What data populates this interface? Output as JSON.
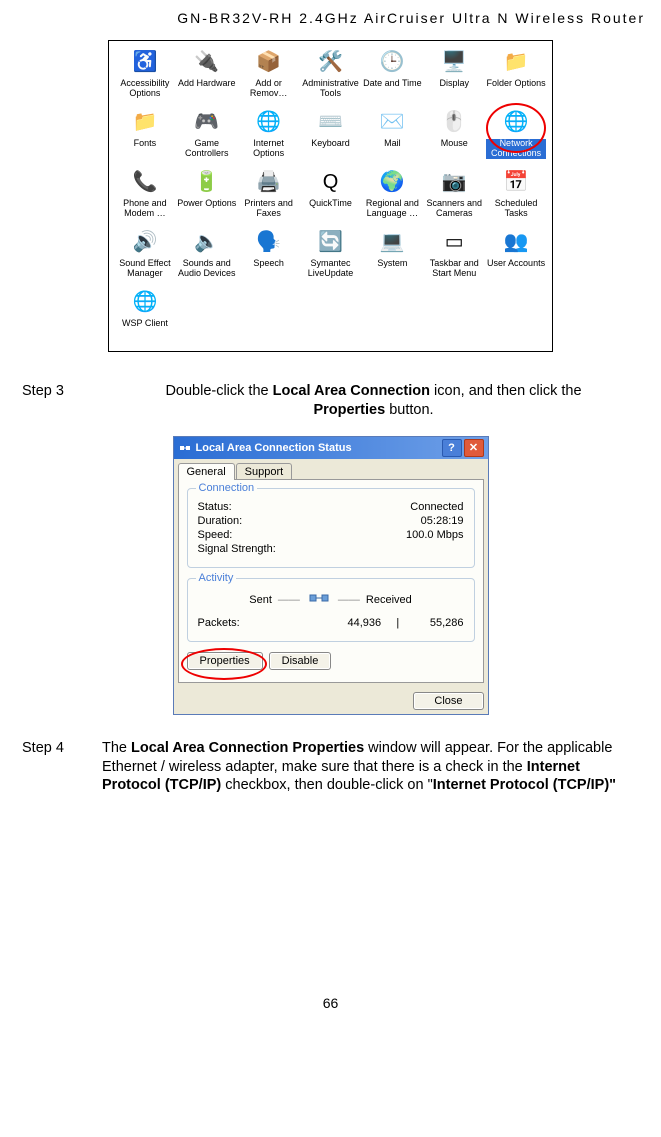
{
  "header": "GN-BR32V-RH  2.4GHz  AirCruiser  Ultra  N  Wireless  Router",
  "controlPanel": {
    "items": [
      {
        "label": "Accessibility Options",
        "glyph": "♿"
      },
      {
        "label": "Add Hardware",
        "glyph": "🔌"
      },
      {
        "label": "Add or Remov…",
        "glyph": "📦"
      },
      {
        "label": "Administrative Tools",
        "glyph": "🛠️"
      },
      {
        "label": "Date and Time",
        "glyph": "🕒"
      },
      {
        "label": "Display",
        "glyph": "🖥️"
      },
      {
        "label": "Folder Options",
        "glyph": "📁"
      },
      {
        "label": "Fonts",
        "glyph": "📁"
      },
      {
        "label": "Game Controllers",
        "glyph": "🎮"
      },
      {
        "label": "Internet Options",
        "glyph": "🌐"
      },
      {
        "label": "Keyboard",
        "glyph": "⌨️"
      },
      {
        "label": "Mail",
        "glyph": "✉️"
      },
      {
        "label": "Mouse",
        "glyph": "🖱️"
      },
      {
        "label": "Network Connections",
        "glyph": "🌐",
        "selected": true,
        "highlighted": true
      },
      {
        "label": "Phone and Modem …",
        "glyph": "📞"
      },
      {
        "label": "Power Options",
        "glyph": "🔋"
      },
      {
        "label": "Printers and Faxes",
        "glyph": "🖨️"
      },
      {
        "label": "QuickTime",
        "glyph": "Q"
      },
      {
        "label": "Regional and Language …",
        "glyph": "🌍"
      },
      {
        "label": "Scanners and Cameras",
        "glyph": "📷"
      },
      {
        "label": "Scheduled Tasks",
        "glyph": "📅"
      },
      {
        "label": "Sound Effect Manager",
        "glyph": "🔊"
      },
      {
        "label": "Sounds and Audio Devices",
        "glyph": "🔈"
      },
      {
        "label": "Speech",
        "glyph": "🗣️"
      },
      {
        "label": "Symantec LiveUpdate",
        "glyph": "🔄"
      },
      {
        "label": "System",
        "glyph": "💻"
      },
      {
        "label": "Taskbar and Start Menu",
        "glyph": "▭"
      },
      {
        "label": "User Accounts",
        "glyph": "👥"
      },
      {
        "label": "WSP Client",
        "glyph": "🌐"
      }
    ]
  },
  "step3": {
    "label": "Step 3",
    "pre": "Double-click the ",
    "b1": "Local Area Connection",
    "mid": " icon, and then click the ",
    "b2": "Properties",
    "post": " button."
  },
  "dialog": {
    "title": "Local Area Connection Status",
    "helpSymbol": "?",
    "closeSymbol": "✕",
    "tabs": {
      "general": "General",
      "support": "Support"
    },
    "connection": {
      "legend": "Connection",
      "statusLabel": "Status:",
      "statusValue": "Connected",
      "durationLabel": "Duration:",
      "durationValue": "05:28:19",
      "speedLabel": "Speed:",
      "speedValue": "100.0 Mbps",
      "signalLabel": "Signal Strength:",
      "signalValue": ""
    },
    "activity": {
      "legend": "Activity",
      "sent": "Sent",
      "received": "Received",
      "dash": "——",
      "packetsLabel": "Packets:",
      "sentVal": "44,936",
      "sep": "|",
      "recvVal": "55,286"
    },
    "buttons": {
      "properties": "Properties",
      "disable": "Disable",
      "close": "Close"
    }
  },
  "step4": {
    "label": "Step 4",
    "pre": "The ",
    "b1": "Local Area Connection Properties",
    "mid1": " window will appear. For the applicable Ethernet / wireless adapter, make sure that there is a check in the ",
    "b2": "Internet Protocol (TCP/IP)",
    "mid2": " checkbox, then double-click on \"",
    "b3": "Internet Protocol (TCP/IP)\"",
    "post": ""
  },
  "pageNumber": "66"
}
